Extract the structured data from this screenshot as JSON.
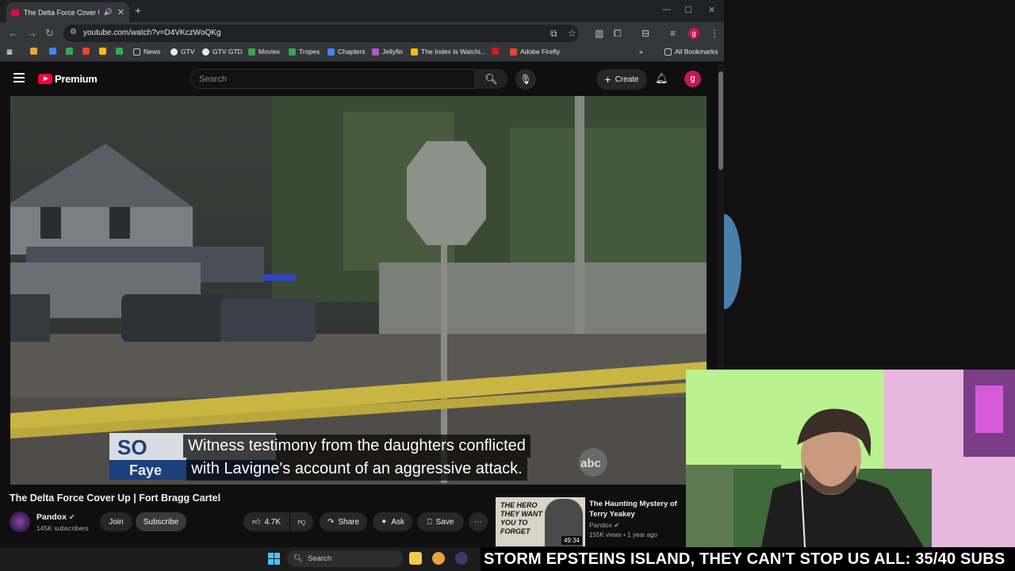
{
  "browser": {
    "tab_title": "The Delta Force Cover Up |",
    "url": "youtube.com/watch?v=D4VKczWoQKg",
    "profile_initial": "g",
    "bookmarks": [
      {
        "label": "News",
        "color": "#8ab4f8"
      },
      {
        "label": "GTV",
        "color": "#e8eaed"
      },
      {
        "label": "GTV GTD",
        "color": "#e8eaed"
      },
      {
        "label": "Movies",
        "color": "#34a853"
      },
      {
        "label": "Tropes",
        "color": "#34a853"
      },
      {
        "label": "Chapters",
        "color": "#4285f4"
      },
      {
        "label": "Jellyfin",
        "color": "#aa5cc3"
      },
      {
        "label": "The Index Is Watchi...",
        "color": "#fbbc04"
      },
      {
        "label": "Adobe Firefly",
        "color": "#ea4335"
      }
    ],
    "all_bookmarks": "All Bookmarks"
  },
  "youtube": {
    "logo_text": "Premium",
    "search_placeholder": "Search",
    "create_label": "Create",
    "avatar_initial": "g",
    "subtitle_line1": "Witness testimony from the daughters conflicted",
    "subtitle_line2": "with Lavigne's account of an aggressive attack.",
    "video_title": "The Delta Force Cover Up | Fort Bragg Cartel",
    "channel_name": "Pandox",
    "channel_subs": "145K subscribers",
    "join_label": "Join",
    "subscribe_label": "Subscribe",
    "likes": "4.7K",
    "share_label": "Share",
    "ask_label": "Ask",
    "save_label": "Save",
    "recommended": {
      "thumb_text": "THE HERO THEY WANT YOU TO FORGET",
      "duration": "49:34",
      "title": "The Haunting Mystery of Terry Yeakey",
      "channel": "Pandox",
      "meta": "155K views • 1 year ago"
    },
    "video_overlay": {
      "lower_third": "SO",
      "lower_third2": "Faye",
      "logo": "abc"
    }
  },
  "taskbar": {
    "search_placeholder": "Search"
  },
  "ticker_text": "STORM EPSTEINS ISLAND, THEY CAN'T STOP US ALL: 35/40 SUBS",
  "colors": {
    "youtube_red": "#ff0033",
    "accent_avatar": "#c2185b",
    "windows_blue": "#4cc2ff"
  }
}
